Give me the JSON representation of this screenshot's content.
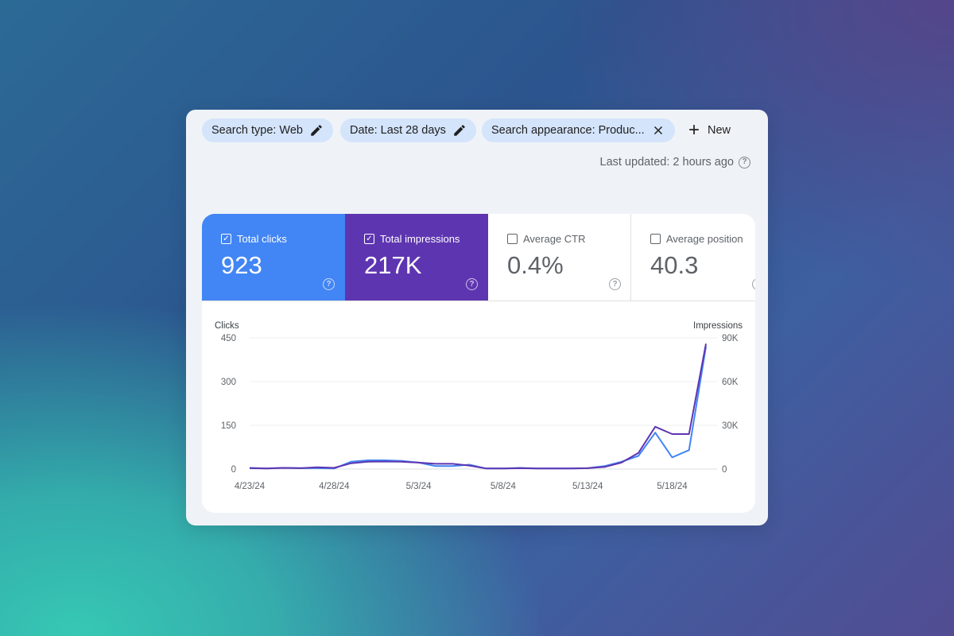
{
  "filters": [
    {
      "label": "Search type: Web",
      "icon": "pencil-icon"
    },
    {
      "label": "Date: Last 28 days",
      "icon": "pencil-icon"
    },
    {
      "label": "Search appearance: Produc...",
      "icon": "close-icon"
    }
  ],
  "new_button": {
    "label": "New",
    "icon": "plus-icon"
  },
  "last_updated": "Last updated: 2 hours ago",
  "metrics": [
    {
      "label": "Total clicks",
      "value": "923",
      "checked": true,
      "color": "#4285f4"
    },
    {
      "label": "Total impressions",
      "value": "217K",
      "checked": true,
      "color": "#5e35b1"
    },
    {
      "label": "Average CTR",
      "value": "0.4%",
      "checked": false
    },
    {
      "label": "Average position",
      "value": "40.3",
      "checked": false
    }
  ],
  "chart_data": {
    "type": "line",
    "ylabel_left": "Clicks",
    "ylabel_right": "Impressions",
    "yticks_left": [
      "450",
      "300",
      "150",
      "0"
    ],
    "yticks_right": [
      "90K",
      "60K",
      "30K",
      "0"
    ],
    "ylim_left": [
      0,
      450
    ],
    "ylim_right": [
      0,
      90000
    ],
    "x_tick_labels": [
      "4/23/24",
      "4/28/24",
      "5/3/24",
      "5/8/24",
      "5/13/24",
      "5/18/24"
    ],
    "x": [
      "4/23/24",
      "4/24/24",
      "4/25/24",
      "4/26/24",
      "4/27/24",
      "4/28/24",
      "4/29/24",
      "4/30/24",
      "5/1/24",
      "5/2/24",
      "5/3/24",
      "5/4/24",
      "5/5/24",
      "5/6/24",
      "5/7/24",
      "5/8/24",
      "5/9/24",
      "5/10/24",
      "5/11/24",
      "5/12/24",
      "5/13/24",
      "5/14/24",
      "5/15/24",
      "5/16/24",
      "5/17/24",
      "5/18/24",
      "5/19/24",
      "5/20/24"
    ],
    "grid": true,
    "series": [
      {
        "name": "Total clicks",
        "axis": "left",
        "color": "#4285f4",
        "values": [
          4,
          2,
          4,
          3,
          3,
          2,
          25,
          30,
          30,
          28,
          22,
          10,
          10,
          15,
          2,
          2,
          4,
          2,
          2,
          2,
          3,
          10,
          25,
          45,
          125,
          40,
          65,
          420
        ]
      },
      {
        "name": "Total impressions",
        "axis": "right",
        "color": "#5e35b1",
        "values": [
          600,
          400,
          800,
          600,
          1200,
          800,
          4000,
          5000,
          5200,
          5000,
          4400,
          3600,
          3600,
          2400,
          400,
          400,
          600,
          400,
          400,
          400,
          600,
          1400,
          4400,
          11000,
          29000,
          24000,
          24000,
          86000
        ]
      }
    ]
  }
}
